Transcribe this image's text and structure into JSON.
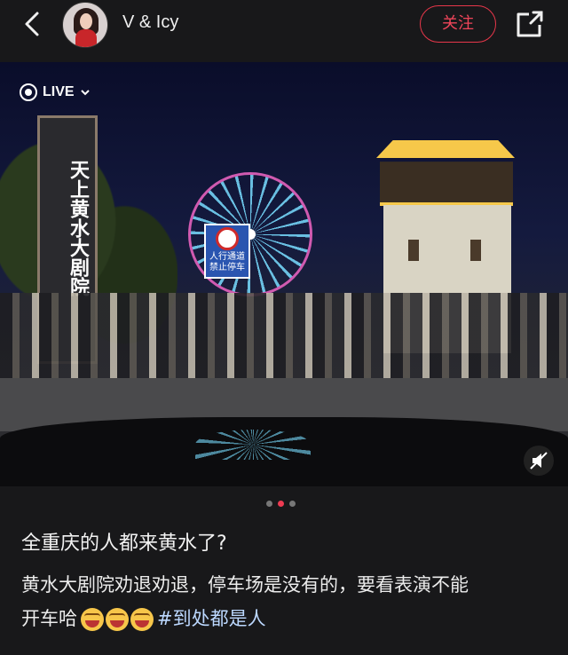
{
  "header": {
    "username": "V & Icy",
    "follow_label": "关注",
    "back_icon": "chevron-left-icon",
    "share_icon": "share-icon"
  },
  "photo": {
    "live_label": "LIVE",
    "pillar_text": "天上黄水大剧院",
    "sign_text": "人行通道 禁止停车",
    "sign_symbol": "停",
    "pagination": {
      "total": 3,
      "active_index": 1
    }
  },
  "post": {
    "title": "全重庆的人都来黄水了?",
    "body_line1": "黄水大剧院劝退劝退，停车场是没有的，要看表演不能",
    "body_line2_prefix": "开车哈",
    "hashtag": "#到处都是人"
  },
  "colors": {
    "background": "#18181a",
    "accent": "#ee3b52",
    "hashtag": "#bcd8ff"
  }
}
